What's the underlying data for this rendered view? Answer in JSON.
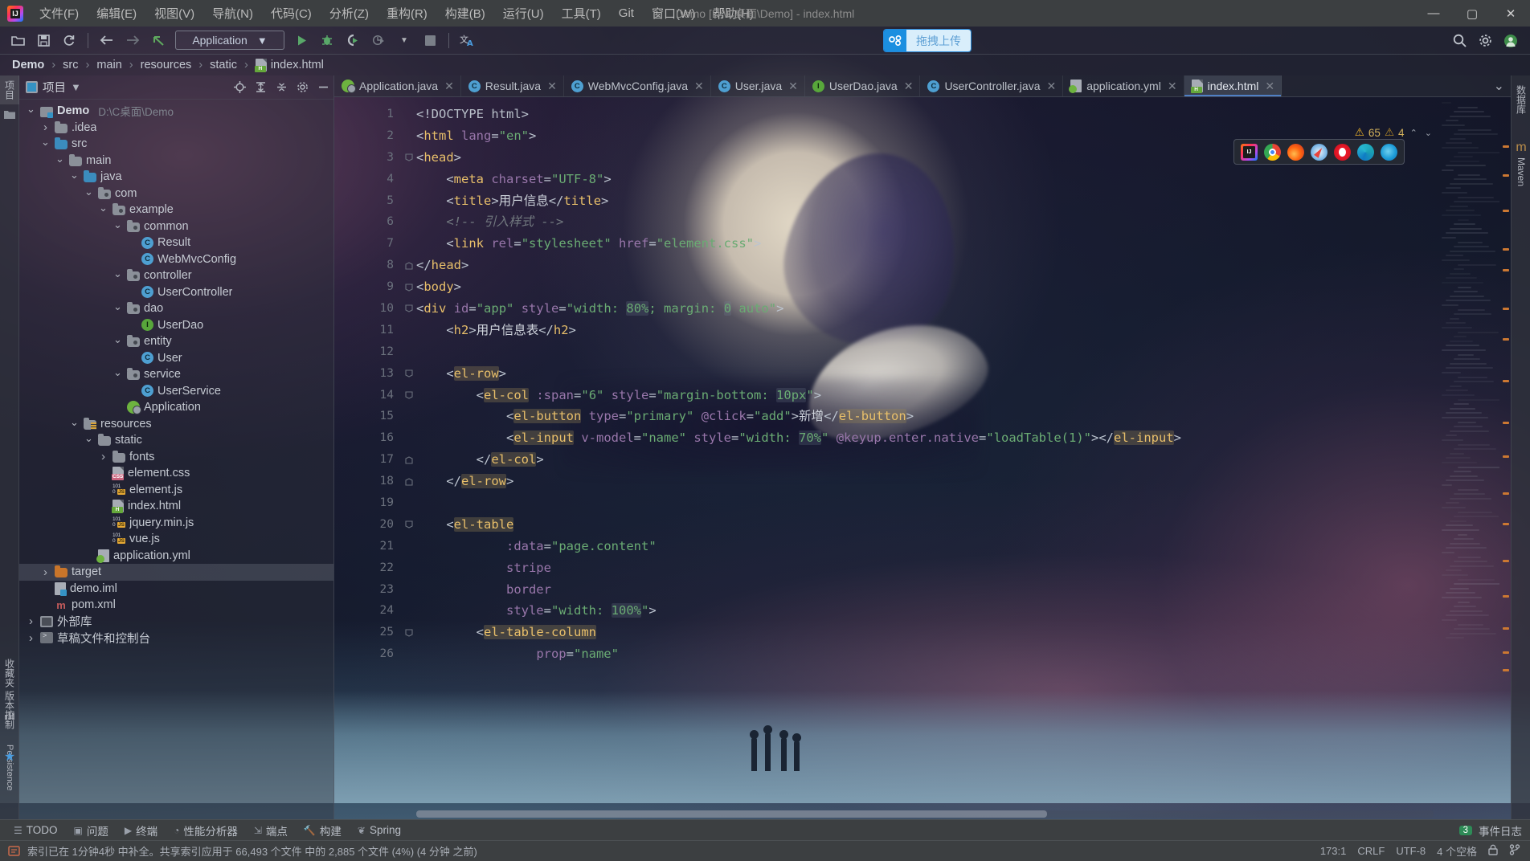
{
  "window": {
    "title": "Demo [D:\\C桌面\\Demo] - index.html",
    "minimize": "—",
    "maximize": "▢",
    "close": "✕"
  },
  "menubar": {
    "app_icon": "intellij-idea-icon",
    "items": [
      {
        "label": "文件(F)"
      },
      {
        "label": "编辑(E)"
      },
      {
        "label": "视图(V)"
      },
      {
        "label": "导航(N)"
      },
      {
        "label": "代码(C)"
      },
      {
        "label": "分析(Z)"
      },
      {
        "label": "重构(R)"
      },
      {
        "label": "构建(B)"
      },
      {
        "label": "运行(U)"
      },
      {
        "label": "工具(T)"
      },
      {
        "label": "Git"
      },
      {
        "label": "窗口(W)"
      },
      {
        "label": "帮助(H)"
      }
    ]
  },
  "toolbar": {
    "open_icon": "open-folder-icon",
    "save_icon": "save-icon",
    "sync_icon": "refresh-icon",
    "back_icon": "arrow-left-icon",
    "forward_icon": "arrow-right-icon",
    "undo_icon": "undo-arrow-icon",
    "run_config": "Application",
    "run_config_caret": "▼",
    "run_icon": "run-icon",
    "debug_icon": "debug-bug-icon",
    "run_coverage_icon": "run-with-coverage-icon",
    "profiler_icon": "profiler-icon",
    "profiler_caret": "▼",
    "stop_icon": "stop-icon",
    "translate_icon": "translate-icon",
    "search_icon": "search-everywhere-icon",
    "settings_icon": "settings-gear-icon",
    "account_icon": "user-account-icon",
    "upload": {
      "icon": "cloud-upload-icon",
      "label": "拖拽上传",
      "accent": "#1b8fe0"
    }
  },
  "breadcrumb": {
    "items": [
      {
        "label": "Demo",
        "root": true
      },
      {
        "label": "src"
      },
      {
        "label": "main"
      },
      {
        "label": "resources"
      },
      {
        "label": "static"
      },
      {
        "label": "index.html",
        "icon": "html-file-icon"
      }
    ],
    "separator": "›"
  },
  "left_rail": {
    "items": [
      {
        "label": "项目",
        "icon": "project-icon",
        "selected": true
      },
      {
        "label": "",
        "icon": "structure-folder-icon",
        "selected": false
      },
      {
        "label": "收藏夹",
        "icon": "bookmarks-icon",
        "selected": false
      },
      {
        "label": "",
        "icon": "build-icon",
        "selected": false
      },
      {
        "label": "版本控制",
        "icon": "vcs-icon",
        "selected": false
      },
      {
        "label": "Persistence",
        "icon": "persistence-icon",
        "selected": false
      }
    ]
  },
  "right_rail": {
    "items": [
      {
        "label": "数据库",
        "icon": "database-icon"
      },
      {
        "label": "Maven",
        "icon": "maven-icon"
      }
    ]
  },
  "project_panel": {
    "title": "项目",
    "title_caret": "▼",
    "actions": [
      {
        "icon": "locate-target-icon",
        "glyph": "⊕"
      },
      {
        "icon": "expand-all-icon",
        "glyph": "⤒"
      },
      {
        "icon": "collapse-all-icon",
        "glyph": "⤓"
      },
      {
        "icon": "settings-gear-icon",
        "glyph": "⚙"
      },
      {
        "icon": "hide-panel-icon",
        "glyph": "—"
      }
    ],
    "tree": [
      {
        "indent": 0,
        "twisty": "v",
        "icon": "module-icon",
        "label": "Demo",
        "bold": true,
        "path": "D:\\C桌面\\Demo"
      },
      {
        "indent": 1,
        "twisty": ">",
        "icon": "folder-icon",
        "label": ".idea"
      },
      {
        "indent": 1,
        "twisty": "v",
        "icon": "folder-src-icon",
        "label": "src"
      },
      {
        "indent": 2,
        "twisty": "v",
        "icon": "folder-icon",
        "label": "main"
      },
      {
        "indent": 3,
        "twisty": "v",
        "icon": "folder-src-icon",
        "label": "java"
      },
      {
        "indent": 4,
        "twisty": "v",
        "icon": "package-icon",
        "label": "com"
      },
      {
        "indent": 5,
        "twisty": "v",
        "icon": "package-icon",
        "label": "example"
      },
      {
        "indent": 6,
        "twisty": "v",
        "icon": "package-icon",
        "label": "common"
      },
      {
        "indent": 7,
        "twisty": "",
        "icon": "java-class-icon",
        "label": "Result"
      },
      {
        "indent": 7,
        "twisty": "",
        "icon": "java-class-icon",
        "label": "WebMvcConfig"
      },
      {
        "indent": 6,
        "twisty": "v",
        "icon": "package-icon",
        "label": "controller"
      },
      {
        "indent": 7,
        "twisty": "",
        "icon": "java-class-icon",
        "label": "UserController"
      },
      {
        "indent": 6,
        "twisty": "v",
        "icon": "package-icon",
        "label": "dao"
      },
      {
        "indent": 7,
        "twisty": "",
        "icon": "java-interface-icon",
        "label": "UserDao"
      },
      {
        "indent": 6,
        "twisty": "v",
        "icon": "package-icon",
        "label": "entity"
      },
      {
        "indent": 7,
        "twisty": "",
        "icon": "java-class-icon",
        "label": "User"
      },
      {
        "indent": 6,
        "twisty": "v",
        "icon": "package-icon",
        "label": "service"
      },
      {
        "indent": 7,
        "twisty": "",
        "icon": "java-class-icon",
        "label": "UserService"
      },
      {
        "indent": 6,
        "twisty": "",
        "icon": "spring-boot-icon",
        "label": "Application"
      },
      {
        "indent": 3,
        "twisty": "v",
        "icon": "folder-resources-icon",
        "label": "resources"
      },
      {
        "indent": 4,
        "twisty": "v",
        "icon": "folder-icon",
        "label": "static"
      },
      {
        "indent": 5,
        "twisty": ">",
        "icon": "folder-icon",
        "label": "fonts"
      },
      {
        "indent": 5,
        "twisty": "",
        "icon": "css-file-icon",
        "label": "element.css"
      },
      {
        "indent": 5,
        "twisty": "",
        "icon": "js-file-icon",
        "label": "element.js"
      },
      {
        "indent": 5,
        "twisty": "",
        "icon": "html-file-icon",
        "label": "index.html"
      },
      {
        "indent": 5,
        "twisty": "",
        "icon": "js-file-icon",
        "label": "jquery.min.js"
      },
      {
        "indent": 5,
        "twisty": "",
        "icon": "js-file-icon",
        "label": "vue.js"
      },
      {
        "indent": 4,
        "twisty": "",
        "icon": "yaml-file-icon",
        "label": "application.yml"
      },
      {
        "indent": 1,
        "twisty": ">",
        "icon": "folder-target-icon",
        "label": "target",
        "selected": true
      },
      {
        "indent": 1,
        "twisty": "",
        "icon": "iml-file-icon",
        "label": "demo.iml"
      },
      {
        "indent": 1,
        "twisty": "",
        "icon": "maven-pom-icon",
        "label": "pom.xml"
      },
      {
        "indent": 0,
        "twisty": ">",
        "icon": "external-libraries-icon",
        "label": "外部库"
      },
      {
        "indent": 0,
        "twisty": ">",
        "icon": "scratches-console-icon",
        "label": "草稿文件和控制台"
      }
    ]
  },
  "editor": {
    "tabs": [
      {
        "label": "Application.java",
        "icon": "spring-boot-icon",
        "active": false,
        "close": "✕"
      },
      {
        "label": "Result.java",
        "icon": "java-class-icon",
        "active": false,
        "close": "✕"
      },
      {
        "label": "WebMvcConfig.java",
        "icon": "java-class-icon",
        "active": false,
        "close": "✕"
      },
      {
        "label": "User.java",
        "icon": "java-class-icon",
        "active": false,
        "close": "✕"
      },
      {
        "label": "UserDao.java",
        "icon": "java-interface-icon",
        "active": false,
        "close": "✕"
      },
      {
        "label": "UserController.java",
        "icon": "java-class-icon",
        "active": false,
        "close": "✕"
      },
      {
        "label": "application.yml",
        "icon": "yaml-file-icon",
        "active": false,
        "close": "✕"
      },
      {
        "label": "index.html",
        "icon": "html-file-icon",
        "active": true,
        "close": "✕"
      }
    ],
    "tabs_overflow_icon": "chevron-down-icon",
    "tabs_overflow_glyph": "⌄",
    "inspection": {
      "warning_icon": "warning-triangle-icon",
      "warning_count": "65",
      "weak_warning_icon": "weak-warning-icon",
      "weak_warning_count": "4",
      "prev_glyph": "⌃",
      "next_glyph": "⌄"
    },
    "browsers": [
      {
        "name": "intellij-preview-icon"
      },
      {
        "name": "chrome-icon"
      },
      {
        "name": "firefox-icon"
      },
      {
        "name": "safari-icon"
      },
      {
        "name": "opera-icon"
      },
      {
        "name": "edge-icon"
      },
      {
        "name": "ie-icon"
      }
    ],
    "first_line": 1,
    "lines": [
      {
        "n": 1,
        "fold": "",
        "html": "<span class='tk-punct'>&lt;!</span><span class='tk-doct'>DOCTYPE html</span><span class='tk-punct'>&gt;</span>"
      },
      {
        "n": 2,
        "fold": "",
        "html": "<span class='tk-punct'>&lt;</span><span class='tk-tag'>html</span> <span class='tk-attr'>lang</span><span class='tk-punct'>=</span><span class='tk-str'>\"en\"</span><span class='tk-punct'>&gt;</span>"
      },
      {
        "n": 3,
        "fold": "v",
        "html": "<span class='tk-punct'>&lt;</span><span class='tk-tag'>head</span><span class='tk-punct'>&gt;</span>"
      },
      {
        "n": 4,
        "fold": "",
        "html": "    <span class='tk-punct'>&lt;</span><span class='tk-tag'>meta</span> <span class='tk-attr'>charset</span><span class='tk-punct'>=</span><span class='tk-str'>\"UTF-8\"</span><span class='tk-punct'>&gt;</span>"
      },
      {
        "n": 5,
        "fold": "",
        "html": "    <span class='tk-punct'>&lt;</span><span class='tk-tag'>title</span><span class='tk-punct'>&gt;</span><span class='tk-txt'>用户信息</span><span class='tk-punct'>&lt;/</span><span class='tk-tag'>title</span><span class='tk-punct'>&gt;</span>"
      },
      {
        "n": 6,
        "fold": "",
        "html": "    <span class='tk-com'>&lt;!-- 引入样式 --&gt;</span>"
      },
      {
        "n": 7,
        "fold": "",
        "html": "    <span class='tk-punct'>&lt;</span><span class='tk-tag'>link</span> <span class='tk-attr'>rel</span><span class='tk-punct'>=</span><span class='tk-str'>\"stylesheet\"</span> <span class='tk-attr'>href</span><span class='tk-punct'>=</span><span class='tk-str'>\"element.css\"</span><span class='tk-punct'>&gt;</span>"
      },
      {
        "n": 8,
        "fold": "^",
        "html": "<span class='tk-punct'>&lt;/</span><span class='tk-tag'>head</span><span class='tk-punct'>&gt;</span>"
      },
      {
        "n": 9,
        "fold": "v",
        "html": "<span class='tk-punct'>&lt;</span><span class='tk-tag'>body</span><span class='tk-punct'>&gt;</span>"
      },
      {
        "n": 10,
        "fold": "v",
        "html": "<span class='tk-punct'>&lt;</span><span class='tk-tag'>div</span> <span class='tk-attr'>id</span><span class='tk-punct'>=</span><span class='tk-str'>\"app\"</span> <span class='tk-attr'>style</span><span class='tk-punct'>=</span><span class='tk-str'>\"width: </span><span class='tk-str hl2'>80%</span><span class='tk-str'>; margin: </span><span class='tk-str hl2'>0</span><span class='tk-str'> auto\"</span><span class='tk-punct'>&gt;</span>"
      },
      {
        "n": 11,
        "fold": "",
        "html": "    <span class='tk-punct'>&lt;</span><span class='tk-tag'>h2</span><span class='tk-punct'>&gt;</span><span class='tk-txt'>用户信息表</span><span class='tk-punct'>&lt;/</span><span class='tk-tag'>h2</span><span class='tk-punct'>&gt;</span>"
      },
      {
        "n": 12,
        "fold": "",
        "html": ""
      },
      {
        "n": 13,
        "fold": "v",
        "html": "    <span class='tk-punct'>&lt;</span><span class='tk-tag hl'>el-row</span><span class='tk-punct'>&gt;</span>"
      },
      {
        "n": 14,
        "fold": "v",
        "html": "        <span class='tk-punct'>&lt;</span><span class='tk-tag hl'>el-col</span> <span class='tk-attr'>:span</span><span class='tk-punct'>=</span><span class='tk-str'>\"6\"</span> <span class='tk-attr'>style</span><span class='tk-punct'>=</span><span class='tk-str'>\"margin-bottom: </span><span class='tk-str hl2'>10px</span><span class='tk-str'>\"</span><span class='tk-punct'>&gt;</span>"
      },
      {
        "n": 15,
        "fold": "",
        "html": "            <span class='tk-punct'>&lt;</span><span class='tk-tag hl'>el-button</span> <span class='tk-attr'>type</span><span class='tk-punct'>=</span><span class='tk-str'>\"primary\"</span> <span class='tk-attr'>@click</span><span class='tk-punct'>=</span><span class='tk-str'>\"add\"</span><span class='tk-punct'>&gt;</span><span class='tk-txt'>新增</span><span class='tk-punct'>&lt;/</span><span class='tk-tag hl'>el-button</span><span class='tk-punct'>&gt;</span>"
      },
      {
        "n": 16,
        "fold": "",
        "html": "            <span class='tk-punct'>&lt;</span><span class='tk-tag hl'>el-input</span> <span class='tk-attr'>v-model</span><span class='tk-punct'>=</span><span class='tk-str'>\"name\"</span> <span class='tk-attr'>style</span><span class='tk-punct'>=</span><span class='tk-str'>\"width: </span><span class='tk-str hl2'>70%</span><span class='tk-str'>\"</span> <span class='tk-attr'>@keyup.enter.native</span><span class='tk-punct'>=</span><span class='tk-str'>\"loadTable(1)\"</span><span class='tk-punct'>&gt;&lt;/</span><span class='tk-tag hl'>el-input</span><span class='tk-punct'>&gt;</span>"
      },
      {
        "n": 17,
        "fold": "^",
        "html": "        <span class='tk-punct'>&lt;/</span><span class='tk-tag hl'>el-col</span><span class='tk-punct'>&gt;</span>"
      },
      {
        "n": 18,
        "fold": "^",
        "html": "    <span class='tk-punct'>&lt;/</span><span class='tk-tag hl'>el-row</span><span class='tk-punct'>&gt;</span>"
      },
      {
        "n": 19,
        "fold": "",
        "html": ""
      },
      {
        "n": 20,
        "fold": "v",
        "html": "    <span class='tk-punct'>&lt;</span><span class='tk-tag hl'>el-table</span>"
      },
      {
        "n": 21,
        "fold": "",
        "html": "            <span class='tk-attr'>:data</span><span class='tk-punct'>=</span><span class='tk-str'>\"page.content\"</span>"
      },
      {
        "n": 22,
        "fold": "",
        "html": "            <span class='tk-attr'>stripe</span>"
      },
      {
        "n": 23,
        "fold": "",
        "html": "            <span class='tk-attr'>border</span>"
      },
      {
        "n": 24,
        "fold": "",
        "html": "            <span class='tk-attr'>style</span><span class='tk-punct'>=</span><span class='tk-str'>\"width: </span><span class='tk-str hl2'>100%</span><span class='tk-str'>\"</span><span class='tk-punct'>&gt;</span>"
      },
      {
        "n": 25,
        "fold": "v",
        "html": "        <span class='tk-punct'>&lt;</span><span class='tk-tag hl'>el-table-column</span>"
      },
      {
        "n": 26,
        "fold": "",
        "html": "                <span class='tk-attr'>prop</span><span class='tk-punct'>=</span><span class='tk-str'>\"name\"</span>"
      }
    ]
  },
  "bottom_bar": {
    "items": [
      {
        "label": "TODO",
        "icon": "todo-icon",
        "glyph": "☰"
      },
      {
        "label": "问题",
        "icon": "problems-icon",
        "glyph": "▣"
      },
      {
        "label": "终端",
        "icon": "terminal-icon",
        "glyph": "▶"
      },
      {
        "label": "性能分析器",
        "icon": "profiler-icon",
        "glyph": "◔"
      },
      {
        "label": "端点",
        "icon": "endpoints-icon",
        "glyph": "⇲"
      },
      {
        "label": "构建",
        "icon": "build-hammer-icon",
        "glyph": "🔨"
      },
      {
        "label": "Spring",
        "icon": "spring-leaf-icon",
        "glyph": "❦"
      }
    ],
    "right": {
      "count": "3",
      "label": "事件日志",
      "icon": "event-log-icon"
    }
  },
  "statusbar": {
    "icon": "index-warning-icon",
    "message": "索引已在 1分钟4秒 中补全。共享索引应用于 66,493 个文件 中的 2,885 个文件 (4%) (4 分钟 之前)",
    "right": {
      "caret": "173:1",
      "line_sep": "CRLF",
      "encoding": "UTF-8",
      "indent": "4 个空格",
      "lock_icon": "lock-icon",
      "branch_icon": "git-branch-icon"
    }
  }
}
